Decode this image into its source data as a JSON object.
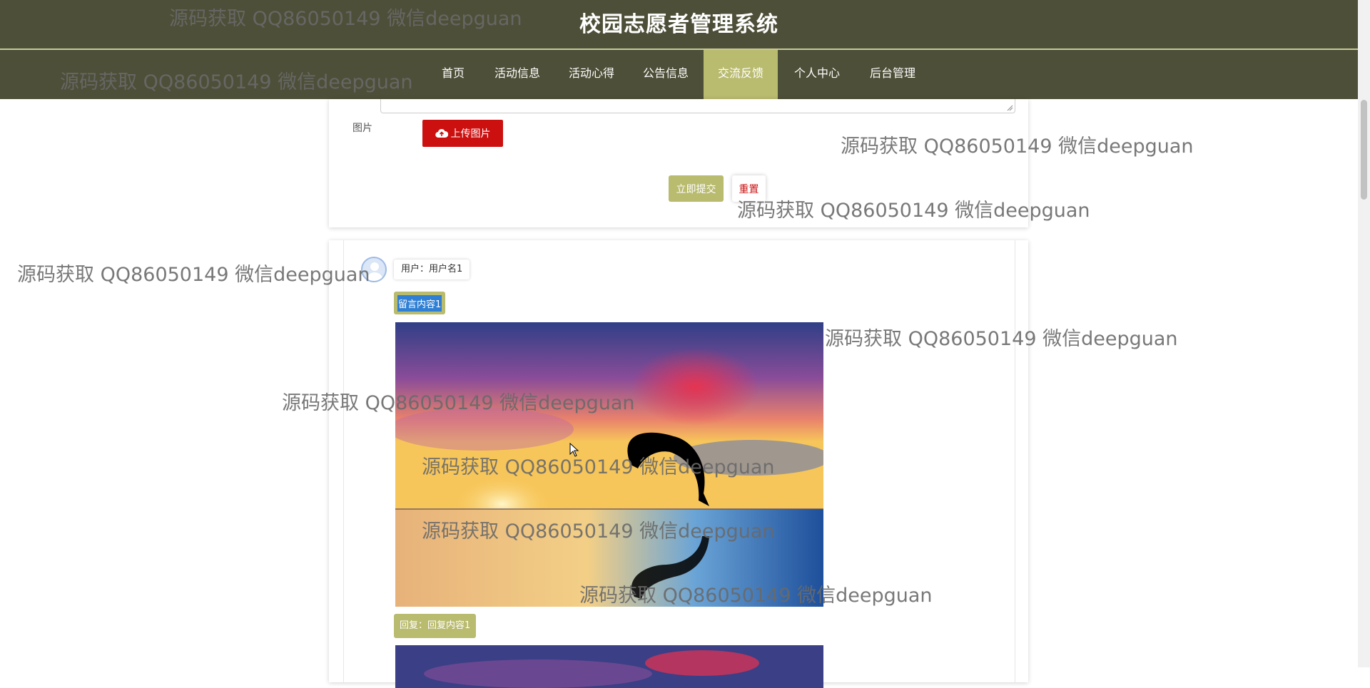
{
  "header": {
    "title": "校园志愿者管理系统"
  },
  "nav": {
    "items": [
      {
        "label": "首页"
      },
      {
        "label": "活动信息"
      },
      {
        "label": "活动心得"
      },
      {
        "label": "公告信息"
      },
      {
        "label": "交流反馈",
        "active": true
      },
      {
        "label": "个人中心"
      },
      {
        "label": "后台管理"
      }
    ]
  },
  "form": {
    "image_label": "图片",
    "upload_label": "上传图片",
    "submit_label": "立即提交",
    "reset_label": "重置"
  },
  "post": {
    "user": "用户：用户名1",
    "content": "留言内容1",
    "reply": "回复：回复内容1"
  },
  "watermark": {
    "text": "源码获取 QQ86050149 微信deepguan"
  },
  "colors": {
    "header_bg": "#4e4f38",
    "accent": "#b9bb6f",
    "upload_button": "#cc1010"
  },
  "icons": {
    "upload": "cloud-upload-icon",
    "avatar": "user-avatar-icon"
  }
}
